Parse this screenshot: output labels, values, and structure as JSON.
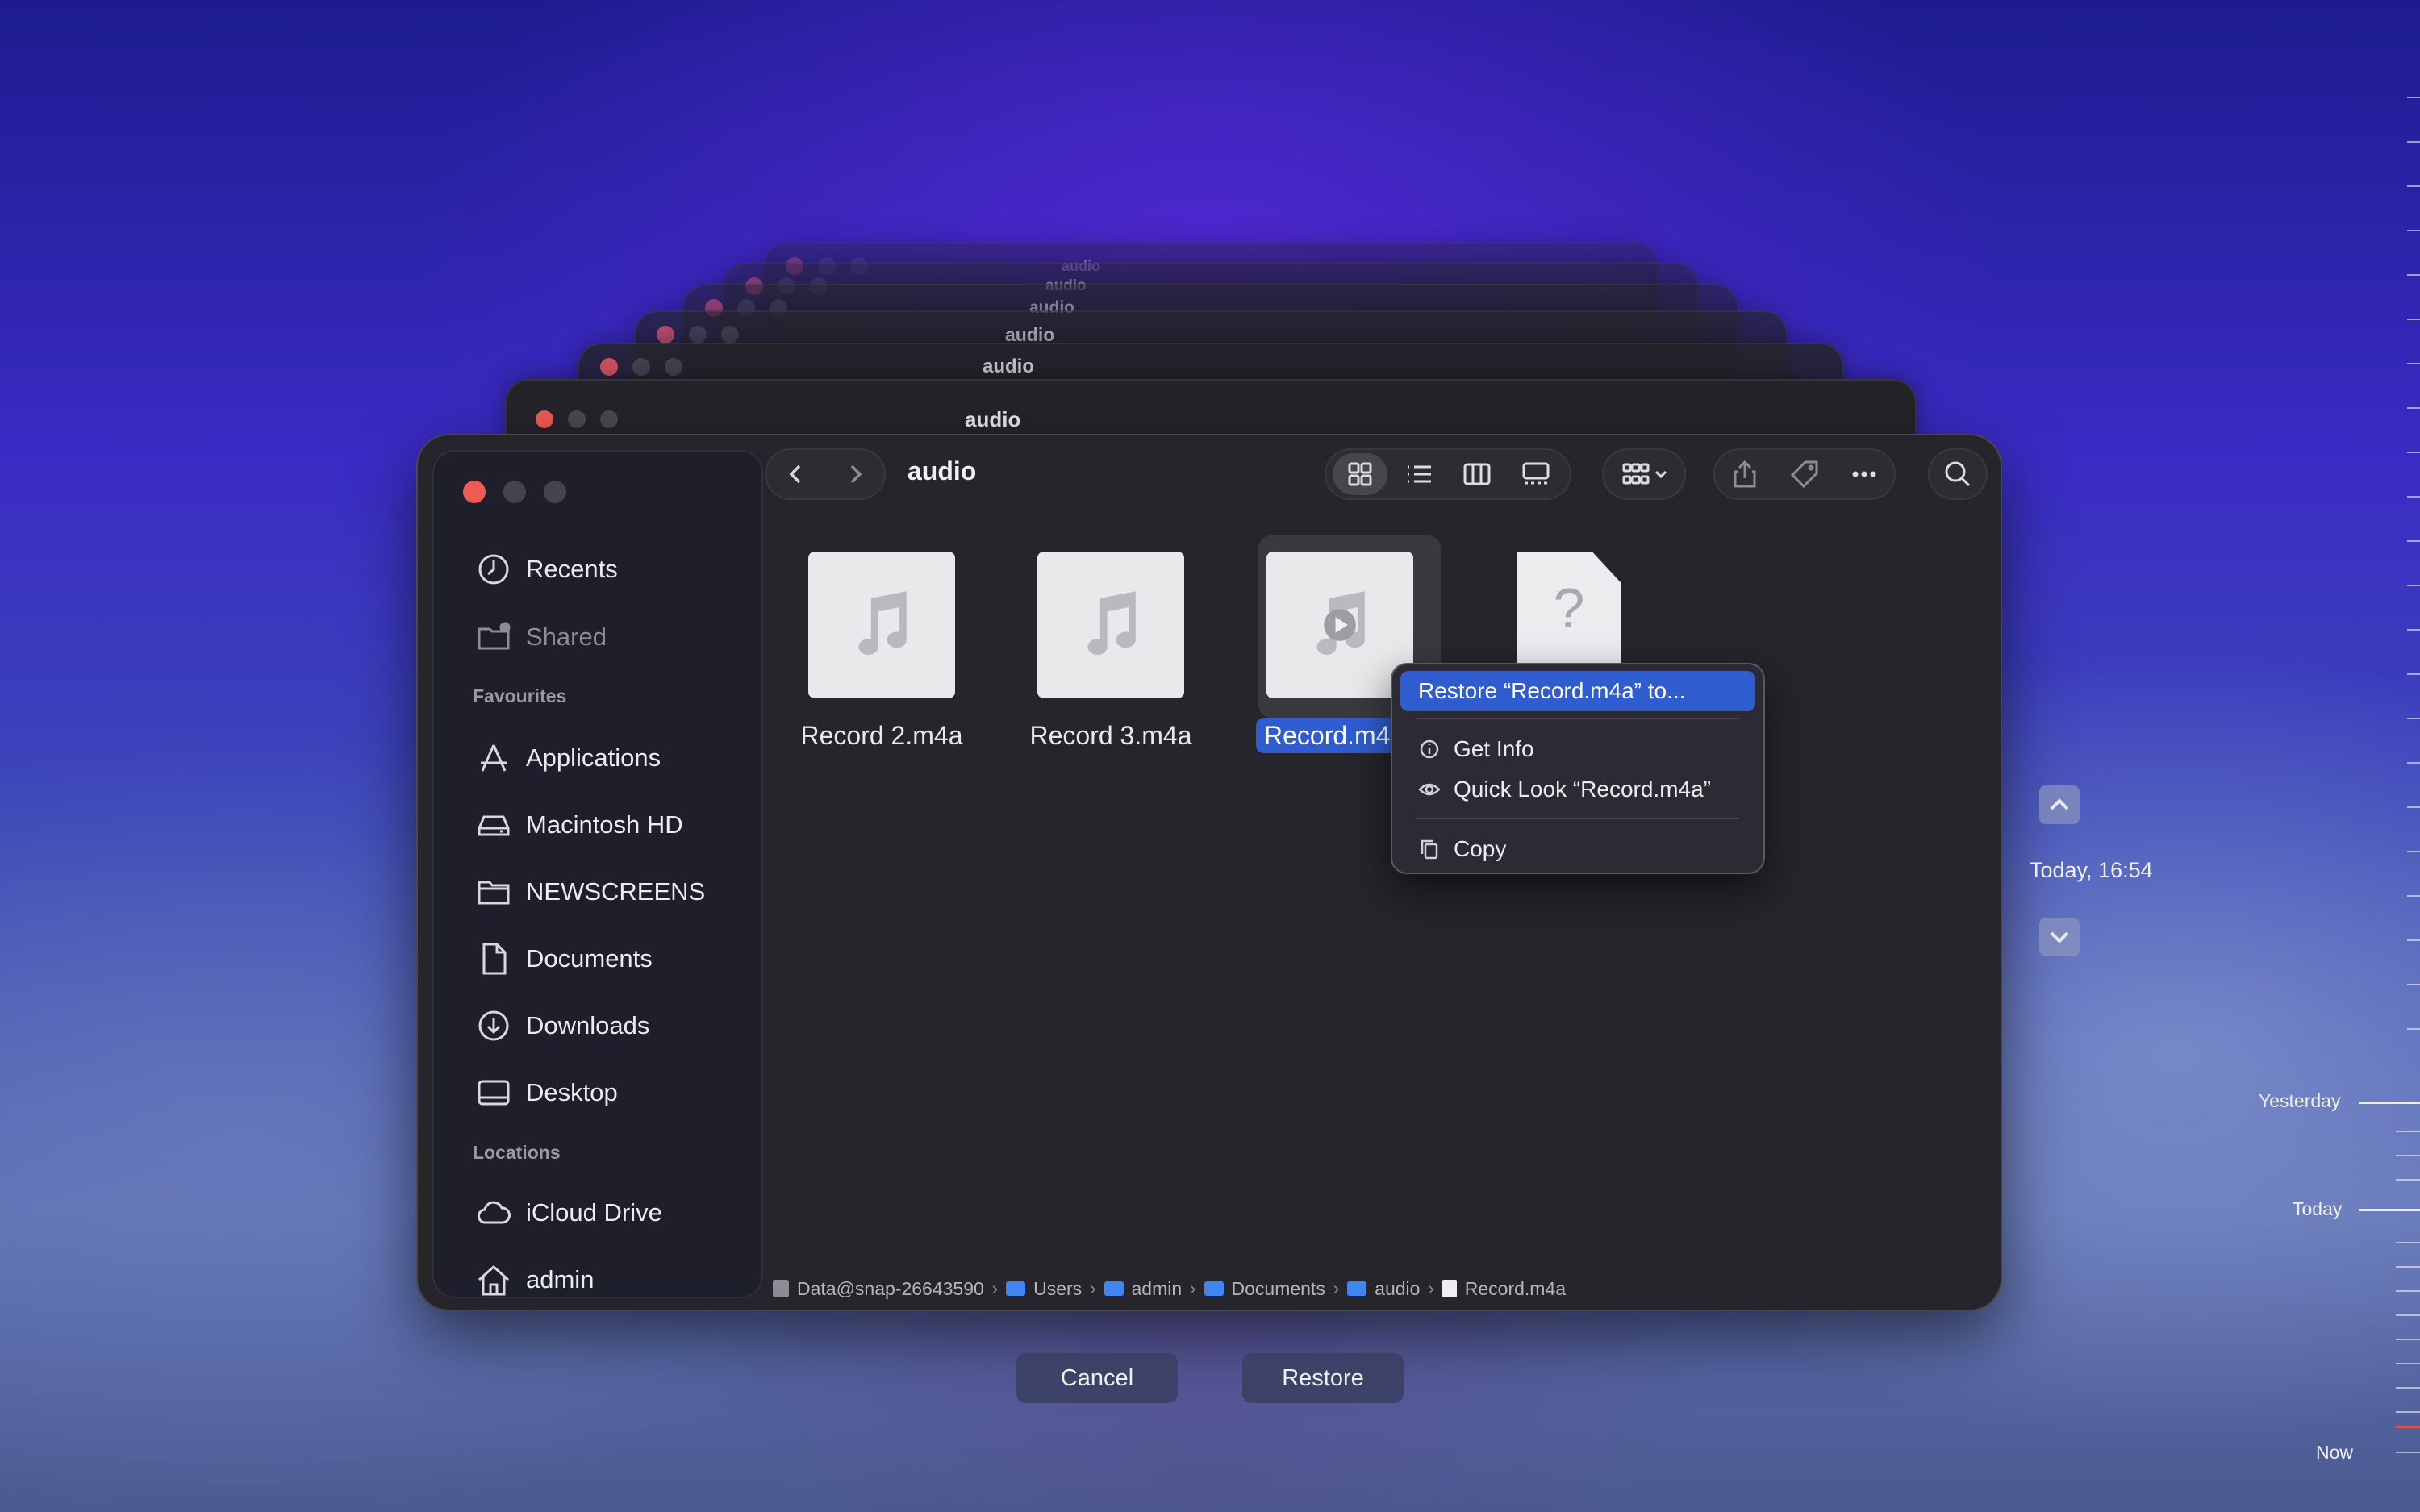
{
  "window": {
    "folder_title": "audio",
    "sidebar": {
      "favourites_header": "Favourites",
      "locations_header": "Locations",
      "top_items": [
        {
          "label": "Recents",
          "icon": "clock-icon"
        },
        {
          "label": "Shared",
          "icon": "shared-folder-icon"
        }
      ],
      "favourites": [
        {
          "label": "Applications",
          "icon": "applications-icon"
        },
        {
          "label": "Macintosh HD",
          "icon": "hard-drive-icon"
        },
        {
          "label": "NEWSCREENS",
          "icon": "folder-icon"
        },
        {
          "label": "Documents",
          "icon": "document-icon"
        },
        {
          "label": "Downloads",
          "icon": "download-icon"
        },
        {
          "label": "Desktop",
          "icon": "desktop-icon"
        }
      ],
      "locations": [
        {
          "label": "iCloud Drive",
          "icon": "cloud-icon"
        },
        {
          "label": "admin",
          "icon": "home-icon"
        }
      ]
    },
    "files": [
      {
        "name": "Record 2.m4a",
        "icon": "music-note-icon"
      },
      {
        "name": "Record 3.m4a",
        "icon": "music-note-icon"
      },
      {
        "name": "Record.m4",
        "icon": "music-play-icon",
        "selected": true
      },
      {
        "name": "",
        "icon": "unknown-file-icon"
      }
    ],
    "path": [
      "Data@snap-26643590",
      "Users",
      "admin",
      "Documents",
      "audio",
      "Record.m4a"
    ]
  },
  "context_menu": {
    "restore": "Restore “Record.m4a” to...",
    "get_info": "Get Info",
    "quick_look": "Quick Look “Record.m4a”",
    "copy": "Copy"
  },
  "buttons": {
    "cancel": "Cancel",
    "restore": "Restore"
  },
  "time_machine": {
    "current_date": "Today, 16:54",
    "timeline": {
      "yesterday": "Yesterday",
      "today": "Today",
      "now": "Now"
    }
  },
  "ghost_windows": [
    {
      "title": "audio"
    },
    {
      "title": "audio"
    },
    {
      "title": "audio"
    },
    {
      "title": "audio"
    },
    {
      "title": "audio"
    },
    {
      "title": "audio"
    }
  ],
  "colors": {
    "accent": "#2f5dd0",
    "close_red": "#ee5b52",
    "timeline_now": "#e05050"
  }
}
